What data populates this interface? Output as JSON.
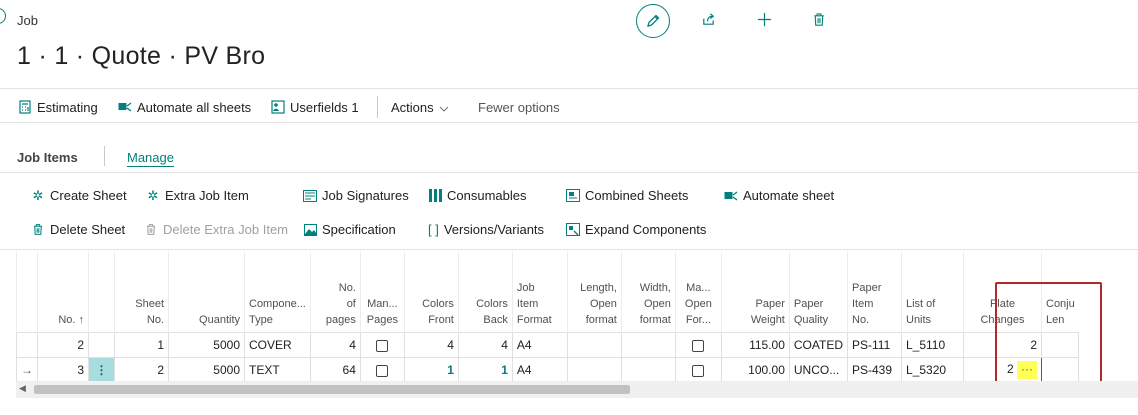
{
  "header": {
    "breadcrumb": "Job",
    "title": "1 · 1 · Quote · PV Bro"
  },
  "actions": {
    "estimating": "Estimating",
    "automate_all": "Automate all sheets",
    "userfields": "Userfields 1",
    "actions": "Actions",
    "fewer": "Fewer options"
  },
  "part": {
    "title": "Job Items",
    "manage": "Manage"
  },
  "toolbar": {
    "create_sheet": "Create Sheet",
    "extra_job_item": "Extra Job Item",
    "job_signatures": "Job Signatures",
    "consumables": "Consumables",
    "combined_sheets": "Combined Sheets",
    "automate_sheet": "Automate sheet",
    "delete_sheet": "Delete Sheet",
    "delete_extra": "Delete Extra Job Item",
    "specification": "Specification",
    "versions": "Versions/Variants",
    "expand": "Expand Components"
  },
  "columns": {
    "no": "No. ↑",
    "sheet_no_1": "Sheet",
    "sheet_no_2": "No.",
    "quantity": "Quantity",
    "comp_1": "Compone...",
    "comp_2": "Type",
    "pages_1": "No.",
    "pages_2": "of",
    "pages_3": "pages",
    "man_1": "Man...",
    "man_2": "Pages",
    "cf_1": "Colors",
    "cf_2": "Front",
    "cb_1": "Colors",
    "cb_2": "Back",
    "fmt_1": "Job",
    "fmt_2": "Item",
    "fmt_3": "Format",
    "len_1": "Length,",
    "len_2": "Open",
    "len_3": "format",
    "wid_1": "Width,",
    "wid_2": "Open",
    "wid_3": "format",
    "mo_1": "Ma...",
    "mo_2": "Open",
    "mo_3": "For...",
    "pw_1": "Paper",
    "pw_2": "Weight",
    "pq_1": "Paper",
    "pq_2": "Quality",
    "pi_1": "Paper",
    "pi_2": "Item",
    "pi_3": "No.",
    "lu_1": "List of",
    "lu_2": "Units",
    "plate": "Plate Changes",
    "conj_1": "Conju",
    "conj_2": "Len"
  },
  "rows": [
    {
      "no": "2",
      "sheet": "1",
      "qty": "5000",
      "comp": "COVER",
      "pages": "4",
      "cf": "4",
      "cb": "4",
      "fmt": "A4",
      "weight": "115.00",
      "quality": "COATED",
      "item": "PS-111",
      "units": "L_5110",
      "plate": "2"
    },
    {
      "no": "3",
      "sheet": "2",
      "qty": "5000",
      "comp": "TEXT",
      "pages": "64",
      "cf": "1",
      "cb": "1",
      "fmt": "A4",
      "weight": "100.00",
      "quality": "UNCO...",
      "item": "PS-439",
      "units": "L_5320",
      "plate": "2"
    }
  ],
  "row_marker": "→",
  "row_menu": "⋮",
  "ellipsis": "···",
  "colors": {
    "accent": "#00817d",
    "highlight": "#ffff55",
    "annotation": "#b02a2a"
  }
}
